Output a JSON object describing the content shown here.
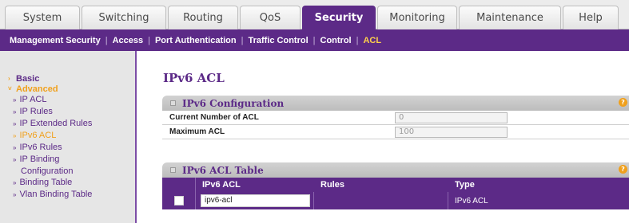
{
  "tabs": [
    {
      "label": "System",
      "active": false
    },
    {
      "label": "Switching",
      "active": false
    },
    {
      "label": "Routing",
      "active": false
    },
    {
      "label": "QoS",
      "active": false
    },
    {
      "label": "Security",
      "active": true
    },
    {
      "label": "Monitoring",
      "active": false
    },
    {
      "label": "Maintenance",
      "active": false
    },
    {
      "label": "Help",
      "active": false
    }
  ],
  "subnav": {
    "items": [
      "Management Security",
      "Access",
      "Port Authentication",
      "Traffic Control",
      "Control",
      "ACL"
    ],
    "active": "ACL",
    "separator": "|"
  },
  "sidebar": {
    "basic": "Basic",
    "advanced": "Advanced",
    "links": [
      "IP ACL",
      "IP Rules",
      "IP Extended Rules",
      "IPv6 ACL",
      "IPv6 Rules",
      "IP Binding"
    ],
    "current": "IPv6 ACL",
    "ip_binding_continued": "Configuration",
    "more_links": [
      "Binding Table",
      "Vlan Binding Table"
    ]
  },
  "page": {
    "title": "IPv6 ACL"
  },
  "config_panel": {
    "title": "IPv6 Configuration",
    "help": "?",
    "rows": [
      {
        "label": "Current Number of ACL",
        "value": "0"
      },
      {
        "label": "Maximum ACL",
        "value": "100"
      }
    ]
  },
  "table_panel": {
    "title": "IPv6 ACL Table",
    "help": "?",
    "columns": [
      "IPv6 ACL",
      "Rules",
      "Type"
    ],
    "rows": [
      {
        "acl": "ipv6-acl",
        "rules": "",
        "type": "IPv6 ACL"
      }
    ]
  },
  "colors": {
    "brand": "#5c2a87",
    "accent": "#f0a01c"
  }
}
